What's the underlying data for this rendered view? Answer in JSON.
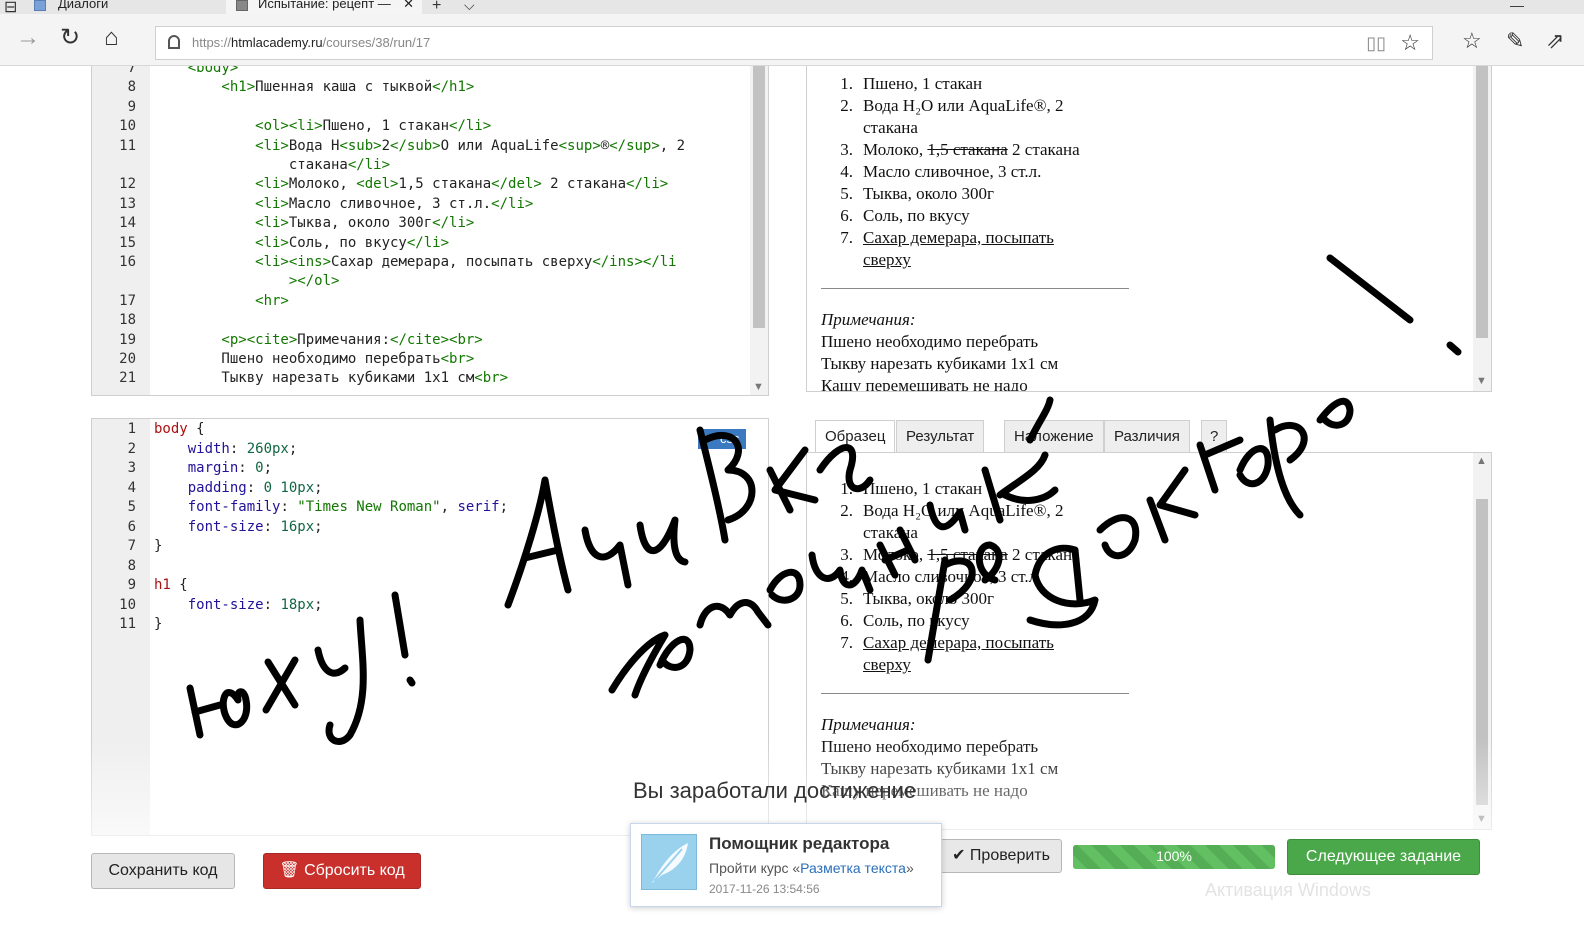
{
  "browser": {
    "tabs": [
      {
        "label": "Диалоги"
      },
      {
        "label": "Испытание: рецепт —",
        "close": "✕"
      }
    ],
    "new_tab": "+",
    "tab_list": "⌵",
    "window_min": "—",
    "url_prefix": "https://",
    "url_host": "htmlacademy.ru",
    "url_path": "/courses/38/run/17"
  },
  "html_editor": {
    "lines": [
      {
        "n": "7",
        "segments": [
          {
            "t": "    <body>",
            "c": "tag"
          }
        ]
      },
      {
        "n": "8",
        "segments": [
          {
            "t": "        <h1>",
            "c": "tag"
          },
          {
            "t": "Пшенная каша с тыквой",
            "c": ""
          },
          {
            "t": "</h1>",
            "c": "tag"
          }
        ]
      },
      {
        "n": "9",
        "segments": []
      },
      {
        "n": "10",
        "segments": [
          {
            "t": "            <ol><li>",
            "c": "tag"
          },
          {
            "t": "Пшено, 1 стакан",
            "c": ""
          },
          {
            "t": "</li>",
            "c": "tag"
          }
        ]
      },
      {
        "n": "11",
        "segments": [
          {
            "t": "            <li>",
            "c": "tag"
          },
          {
            "t": "Вода H",
            "c": ""
          },
          {
            "t": "<sub>",
            "c": "tag"
          },
          {
            "t": "2",
            "c": ""
          },
          {
            "t": "</sub>",
            "c": "tag"
          },
          {
            "t": "O или AquaLife",
            "c": ""
          },
          {
            "t": "<sup>",
            "c": "tag"
          },
          {
            "t": "®",
            "c": ""
          },
          {
            "t": "</sup>",
            "c": "tag"
          },
          {
            "t": ", 2",
            "c": ""
          }
        ]
      },
      {
        "n": "",
        "segments": [
          {
            "t": "                стакана",
            "c": ""
          },
          {
            "t": "</li>",
            "c": "tag"
          }
        ]
      },
      {
        "n": "12",
        "segments": [
          {
            "t": "            <li>",
            "c": "tag"
          },
          {
            "t": "Молоко, ",
            "c": ""
          },
          {
            "t": "<del>",
            "c": "tag"
          },
          {
            "t": "1,5 стакана",
            "c": ""
          },
          {
            "t": "</del>",
            "c": "tag"
          },
          {
            "t": " 2 стакана",
            "c": ""
          },
          {
            "t": "</li>",
            "c": "tag"
          }
        ]
      },
      {
        "n": "13",
        "segments": [
          {
            "t": "            <li>",
            "c": "tag"
          },
          {
            "t": "Масло сливочное, 3 ст.л.",
            "c": ""
          },
          {
            "t": "</li>",
            "c": "tag"
          }
        ]
      },
      {
        "n": "14",
        "segments": [
          {
            "t": "            <li>",
            "c": "tag"
          },
          {
            "t": "Тыква, около 300г",
            "c": ""
          },
          {
            "t": "</li>",
            "c": "tag"
          }
        ]
      },
      {
        "n": "15",
        "segments": [
          {
            "t": "            <li>",
            "c": "tag"
          },
          {
            "t": "Соль, по вкусу",
            "c": ""
          },
          {
            "t": "</li>",
            "c": "tag"
          }
        ]
      },
      {
        "n": "16",
        "segments": [
          {
            "t": "            <li><ins>",
            "c": "tag"
          },
          {
            "t": "Сахар демерара, посыпать сверху",
            "c": ""
          },
          {
            "t": "</ins></li",
            "c": "tag"
          }
        ]
      },
      {
        "n": "",
        "segments": [
          {
            "t": "                ></ol>",
            "c": "tag"
          }
        ]
      },
      {
        "n": "17",
        "segments": [
          {
            "t": "            <hr>",
            "c": "tag"
          }
        ]
      },
      {
        "n": "18",
        "segments": []
      },
      {
        "n": "19",
        "segments": [
          {
            "t": "        <p><cite>",
            "c": "tag"
          },
          {
            "t": "Примечания:",
            "c": ""
          },
          {
            "t": "</cite><br>",
            "c": "tag"
          }
        ]
      },
      {
        "n": "20",
        "segments": [
          {
            "t": "        Пшено необходимо перебрать",
            "c": ""
          },
          {
            "t": "<br>",
            "c": "tag"
          }
        ]
      },
      {
        "n": "21",
        "segments": [
          {
            "t": "        Тыкву нарезать кубиками 1x1 см",
            "c": ""
          },
          {
            "t": "<br>",
            "c": "tag"
          }
        ]
      }
    ]
  },
  "css_editor": {
    "badge": "css",
    "lines": [
      {
        "n": "1",
        "segments": [
          {
            "t": "body",
            "c": "kw"
          },
          {
            "t": " {",
            "c": ""
          }
        ]
      },
      {
        "n": "2",
        "segments": [
          {
            "t": "    width",
            "c": "prop"
          },
          {
            "t": ": ",
            "c": ""
          },
          {
            "t": "260px",
            "c": "num"
          },
          {
            "t": ";",
            "c": ""
          }
        ]
      },
      {
        "n": "3",
        "segments": [
          {
            "t": "    margin",
            "c": "prop"
          },
          {
            "t": ": ",
            "c": ""
          },
          {
            "t": "0",
            "c": "num"
          },
          {
            "t": ";",
            "c": ""
          }
        ]
      },
      {
        "n": "4",
        "segments": [
          {
            "t": "    padding",
            "c": "prop"
          },
          {
            "t": ": ",
            "c": ""
          },
          {
            "t": "0 10px",
            "c": "num"
          },
          {
            "t": ";",
            "c": ""
          }
        ]
      },
      {
        "n": "5",
        "segments": [
          {
            "t": "    font-family",
            "c": "prop"
          },
          {
            "t": ": ",
            "c": ""
          },
          {
            "t": "\"Times New Roman\"",
            "c": "str"
          },
          {
            "t": ", ",
            "c": ""
          },
          {
            "t": "serif",
            "c": "prop"
          },
          {
            "t": ";",
            "c": ""
          }
        ]
      },
      {
        "n": "6",
        "segments": [
          {
            "t": "    font-size",
            "c": "prop"
          },
          {
            "t": ": ",
            "c": ""
          },
          {
            "t": "16px",
            "c": "num"
          },
          {
            "t": ";",
            "c": ""
          }
        ]
      },
      {
        "n": "7",
        "segments": [
          {
            "t": "}",
            "c": ""
          }
        ]
      },
      {
        "n": "8",
        "segments": []
      },
      {
        "n": "9",
        "segments": [
          {
            "t": "h1",
            "c": "kw"
          },
          {
            "t": " {",
            "c": ""
          }
        ]
      },
      {
        "n": "10",
        "segments": [
          {
            "t": "    font-size",
            "c": "prop"
          },
          {
            "t": ": ",
            "c": ""
          },
          {
            "t": "18px",
            "c": "num"
          },
          {
            "t": ";",
            "c": ""
          }
        ]
      },
      {
        "n": "11",
        "segments": [
          {
            "t": "}",
            "c": ""
          }
        ]
      }
    ]
  },
  "preview": {
    "items": [
      {
        "n": "1.",
        "lines": [
          "Пшено, 1 стакан"
        ]
      },
      {
        "n": "2.",
        "lines": [
          "Вода H₂O или AquaLife®, 2",
          "стакана"
        ]
      },
      {
        "n": "3.",
        "pre": "Молоко, ",
        "del": "1,5 стакана",
        "post": " 2 стакана"
      },
      {
        "n": "4.",
        "lines": [
          "Масло сливочное, 3 ст.л."
        ]
      },
      {
        "n": "5.",
        "lines": [
          "Тыква, около 300г"
        ]
      },
      {
        "n": "6.",
        "lines": [
          "Соль, по вкусу"
        ]
      },
      {
        "n": "7.",
        "ins": [
          "Сахар демерара, посыпать",
          "сверху"
        ]
      }
    ],
    "notes_title": "Примечания:",
    "notes": [
      "Пшено необходимо перебрать",
      "Тыкву нарезать кубиками 1x1 см",
      "Кашу перемешивать не надо"
    ]
  },
  "preview_tabs": [
    "Образец",
    "Результат",
    "Наложение",
    "Различия",
    "?"
  ],
  "actions": {
    "save": "Сохранить код",
    "reset": "Сбросить код",
    "check": "Проверить",
    "progress_label": "100%",
    "progress_value": 100,
    "next": "Следующее задание"
  },
  "achievement": {
    "header": "Вы заработали достижение",
    "name": "Помощник редактора",
    "desc_prefix": "Пройти курс «",
    "desc_link": "Разметка текста",
    "desc_suffix": "»",
    "date": "2017-11-26 13:54:56"
  },
  "watermark": "Активация Windows",
  "handwriting": {
    "words": [
      "Юху!",
      "Ачивка",
      "помощник",
      "редактора",
      "!"
    ],
    "color": "#000000"
  }
}
